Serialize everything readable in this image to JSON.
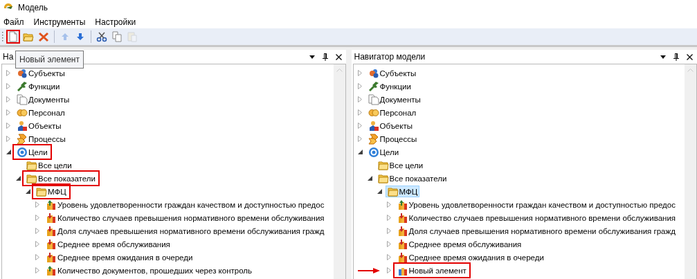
{
  "window": {
    "title": "Модель"
  },
  "menu": [
    "Файл",
    "Инструменты",
    "Настройки"
  ],
  "toolbar": [
    {
      "kind": "new",
      "disabled": false,
      "highlighted": true
    },
    {
      "kind": "open",
      "disabled": false,
      "highlighted": false
    },
    {
      "kind": "delete",
      "disabled": false,
      "highlighted": false
    },
    {
      "kind": "separator"
    },
    {
      "kind": "up",
      "disabled": true,
      "highlighted": false
    },
    {
      "kind": "down",
      "disabled": false,
      "highlighted": false
    },
    {
      "kind": "separator"
    },
    {
      "kind": "cut",
      "disabled": false,
      "highlighted": false
    },
    {
      "kind": "copy",
      "disabled": false,
      "highlighted": false
    },
    {
      "kind": "paste",
      "disabled": true,
      "highlighted": false
    }
  ],
  "tooltip": "Новый элемент",
  "panels": [
    {
      "title": "На",
      "tree": [
        {
          "label": "Субъекты",
          "kind": "people",
          "expandable": true,
          "expanded": false,
          "selected": false,
          "highlighted": false
        },
        {
          "label": "Функции",
          "kind": "functions",
          "expandable": true,
          "expanded": false,
          "selected": false,
          "highlighted": false
        },
        {
          "label": "Документы",
          "kind": "documents",
          "expandable": true,
          "expanded": false,
          "selected": false,
          "highlighted": false
        },
        {
          "label": "Персонал",
          "kind": "personnel",
          "expandable": true,
          "expanded": false,
          "selected": false,
          "highlighted": false
        },
        {
          "label": "Объекты",
          "kind": "objects",
          "expandable": true,
          "expanded": false,
          "selected": false,
          "highlighted": false
        },
        {
          "label": "Процессы",
          "kind": "processes",
          "expandable": true,
          "expanded": false,
          "selected": false,
          "highlighted": false
        },
        {
          "label": "Цели",
          "kind": "goal",
          "expandable": true,
          "expanded": true,
          "selected": false,
          "highlighted": true,
          "children": [
            {
              "label": "Все цели",
              "kind": "folder",
              "selected": false,
              "highlighted": false
            },
            {
              "label": "Все показатели",
              "kind": "folder",
              "expandable": true,
              "expanded": true,
              "selected": false,
              "highlighted": true,
              "children": [
                {
                  "label": "МФЦ",
                  "kind": "folder",
                  "expandable": true,
                  "expanded": true,
                  "selected": false,
                  "highlighted": true,
                  "children": [
                    {
                      "label": "Уровень удовлетворенности граждан качеством и доступностью предос",
                      "kind": "indicator_up",
                      "expandable": true,
                      "expanded": false,
                      "selected": false,
                      "highlighted": false
                    },
                    {
                      "label": "Количество случаев превышения нормативного времени обслуживания",
                      "kind": "indicator_down",
                      "expandable": true,
                      "expanded": false,
                      "selected": false,
                      "highlighted": false
                    },
                    {
                      "label": "Доля случаев превышения нормативного времени обслуживания гражд",
                      "kind": "indicator_down",
                      "expandable": true,
                      "expanded": false,
                      "selected": false,
                      "highlighted": false
                    },
                    {
                      "label": "Среднее время обслуживания",
                      "kind": "indicator_down",
                      "expandable": true,
                      "expanded": false,
                      "selected": false,
                      "highlighted": false
                    },
                    {
                      "label": "Среднее время ожидания в очереди",
                      "kind": "indicator_down",
                      "expandable": true,
                      "expanded": false,
                      "selected": false,
                      "highlighted": false
                    },
                    {
                      "label": "Количество документов, прошедших через контроль",
                      "kind": "indicator_up",
                      "expandable": true,
                      "expanded": false,
                      "selected": false,
                      "highlighted": false
                    }
                  ]
                }
              ]
            }
          ]
        }
      ]
    },
    {
      "title": "Навигатор модели",
      "tree": [
        {
          "label": "Субъекты",
          "kind": "people",
          "expandable": true,
          "expanded": false,
          "selected": false,
          "highlighted": false
        },
        {
          "label": "Функции",
          "kind": "functions",
          "expandable": true,
          "expanded": false,
          "selected": false,
          "highlighted": false
        },
        {
          "label": "Документы",
          "kind": "documents",
          "expandable": true,
          "expanded": false,
          "selected": false,
          "highlighted": false
        },
        {
          "label": "Персонал",
          "kind": "personnel",
          "expandable": true,
          "expanded": false,
          "selected": false,
          "highlighted": false
        },
        {
          "label": "Объекты",
          "kind": "objects",
          "expandable": true,
          "expanded": false,
          "selected": false,
          "highlighted": false
        },
        {
          "label": "Процессы",
          "kind": "processes",
          "expandable": true,
          "expanded": false,
          "selected": false,
          "highlighted": false
        },
        {
          "label": "Цели",
          "kind": "goal",
          "expandable": true,
          "expanded": true,
          "selected": false,
          "highlighted": false,
          "children": [
            {
              "label": "Все цели",
              "kind": "folder",
              "selected": false,
              "highlighted": false
            },
            {
              "label": "Все показатели",
              "kind": "folder",
              "expandable": true,
              "expanded": true,
              "selected": false,
              "highlighted": false,
              "children": [
                {
                  "label": "МФЦ",
                  "kind": "folder",
                  "expandable": true,
                  "expanded": true,
                  "selected": true,
                  "highlighted": false,
                  "children": [
                    {
                      "label": "Уровень удовлетворенности граждан качеством и доступностью предос",
                      "kind": "indicator_up",
                      "expandable": true,
                      "expanded": false,
                      "selected": false,
                      "highlighted": false
                    },
                    {
                      "label": "Количество случаев превышения нормативного времени обслуживания",
                      "kind": "indicator_down",
                      "expandable": true,
                      "expanded": false,
                      "selected": false,
                      "highlighted": false
                    },
                    {
                      "label": "Доля случаев превышения нормативного времени обслуживания гражд",
                      "kind": "indicator_down",
                      "expandable": true,
                      "expanded": false,
                      "selected": false,
                      "highlighted": false
                    },
                    {
                      "label": "Среднее время обслуживания",
                      "kind": "indicator_down",
                      "expandable": true,
                      "expanded": false,
                      "selected": false,
                      "highlighted": false
                    },
                    {
                      "label": "Среднее время ожидания в очереди",
                      "kind": "indicator_down",
                      "expandable": true,
                      "expanded": false,
                      "selected": false,
                      "highlighted": false
                    },
                    {
                      "label": "Новый элемент",
                      "kind": "indicator_plain",
                      "expandable": true,
                      "expanded": false,
                      "selected": false,
                      "highlighted": true,
                      "pointer": true
                    }
                  ]
                }
              ]
            }
          ]
        }
      ]
    }
  ]
}
